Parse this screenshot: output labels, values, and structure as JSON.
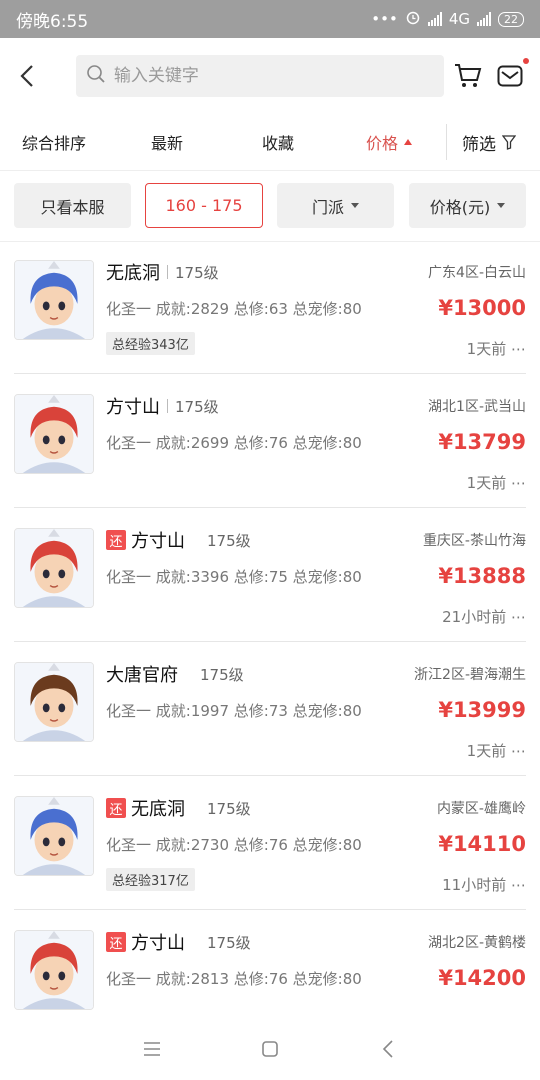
{
  "status_bar": {
    "time": "傍晚6:55",
    "dots": "•••",
    "network": "4G",
    "battery": "22"
  },
  "search": {
    "placeholder": "输入关键字"
  },
  "icons": {
    "back": "back-arrow-icon",
    "search": "search-icon",
    "cart": "cart-icon",
    "mail": "mail-icon"
  },
  "sort_tabs": [
    {
      "label": "综合排序"
    },
    {
      "label": "最新"
    },
    {
      "label": "收藏"
    },
    {
      "label": "价格",
      "active": true
    }
  ],
  "filter_label": "筛选",
  "filters": {
    "server_only": "只看本服",
    "level_range": "160 - 175",
    "sect": "门派",
    "price": "价格(元)"
  },
  "colors": {
    "accent": "#e64340",
    "tag": "#f04f4f"
  },
  "listings": [
    {
      "sect": "无底洞",
      "level": "175级",
      "server": "广东4区-白云山",
      "stats": "化圣一 成就:2829 总修:63 总宠修:80",
      "price": "¥13000",
      "exp": "总经验343亿",
      "time": "1天前",
      "avatar": "blue",
      "returning": false
    },
    {
      "sect": "方寸山",
      "level": "175级",
      "server": "湖北1区-武当山",
      "stats": "化圣一 成就:2699 总修:76 总宠修:80",
      "price": "¥13799",
      "exp": "",
      "time": "1天前",
      "avatar": "red",
      "returning": false
    },
    {
      "sect": "方寸山",
      "level": "175级",
      "server": "重庆区-茶山竹海",
      "stats": "化圣一 成就:3396 总修:75 总宠修:80",
      "price": "¥13888",
      "exp": "",
      "time": "21小时前",
      "avatar": "red",
      "returning": true,
      "tag": "还"
    },
    {
      "sect": "大唐官府",
      "level": "175级",
      "server": "浙江2区-碧海潮生",
      "stats": "化圣一 成就:1997 总修:73 总宠修:80",
      "price": "¥13999",
      "exp": "",
      "time": "1天前",
      "avatar": "brown",
      "returning": false
    },
    {
      "sect": "无底洞",
      "level": "175级",
      "server": "内蒙区-雄鹰岭",
      "stats": "化圣一 成就:2730 总修:76 总宠修:80",
      "price": "¥14110",
      "exp": "总经验317亿",
      "time": "11小时前",
      "avatar": "blue",
      "returning": true,
      "tag": "还"
    },
    {
      "sect": "方寸山",
      "level": "175级",
      "server": "湖北2区-黄鹤楼",
      "stats": "化圣一 成就:2813 总修:76 总宠修:80",
      "price": "¥14200",
      "exp": "",
      "time": "",
      "avatar": "red",
      "returning": true,
      "tag": "还"
    }
  ],
  "more_glyph": "⋯"
}
